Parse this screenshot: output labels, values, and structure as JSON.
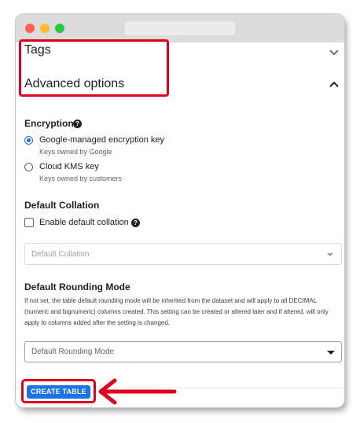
{
  "sections": {
    "tags_title": "Tags",
    "advanced_title": "Advanced options"
  },
  "encryption": {
    "title": "Encryption",
    "options": [
      {
        "label": "Google-managed encryption key",
        "sublabel": "Keys owned by Google",
        "selected": true
      },
      {
        "label": "Cloud KMS key",
        "sublabel": "Keys owned by customers",
        "selected": false
      }
    ]
  },
  "collation": {
    "title": "Default Collation",
    "checkbox_label": "Enable default collation",
    "checked": false,
    "select_placeholder": "Default Collation"
  },
  "rounding": {
    "title": "Default Rounding Mode",
    "description": "If not set, the table default rounding mode will be inherited from the dataset and will apply to all DECIMAL (numeric and bignumeric) columns created. This setting can be created or altered later and if altered, will only apply to columns added after the setting is changed.",
    "select_placeholder": "Default Rounding Mode"
  },
  "footer": {
    "create_button": "CREATE TABLE"
  },
  "colors": {
    "accent": "#1a73e8",
    "highlight": "#e0001b"
  },
  "icons": {
    "tags_toggle": "chevron-down-icon",
    "advanced_toggle": "chevron-up-icon",
    "help": "help-circle-icon",
    "annotation": "arrow-left-icon"
  }
}
